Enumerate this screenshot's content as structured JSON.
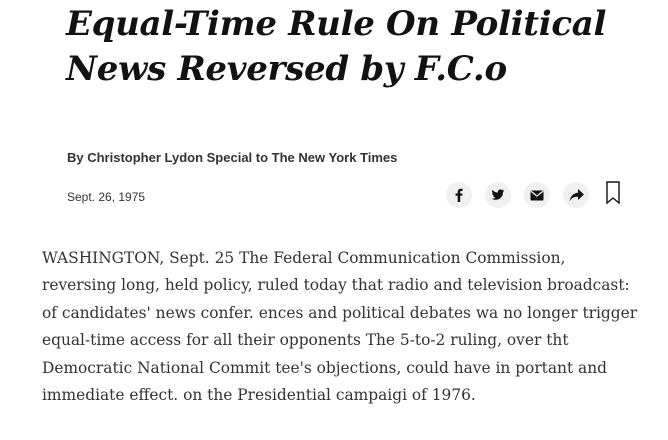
{
  "article": {
    "headline": "Equal-Time Rule On Political News Reversed by F.C.o",
    "byline": "By Christopher Lydon Special to The New York Times",
    "date": "Sept. 26, 1975",
    "body": "WASHINGTON, Sept. 25 The Federal Communication Commission, reversing long, held policy, ruled today that radio and television broadcast: of candidates' news confer. ences and political debates wa no longer trigger equal-time access for all their opponents The 5-to-2 ruling, over tht Democratic National Commit tee's objections, could have in portant and immediate effect. on the Presidential campaigi of 1976."
  },
  "share_tools": {
    "icons": [
      "facebook-icon",
      "twitter-icon",
      "email-icon",
      "share-arrow-icon",
      "bookmark-icon"
    ],
    "button_bg": "#f0f0f0",
    "icon_color": "#121212"
  }
}
